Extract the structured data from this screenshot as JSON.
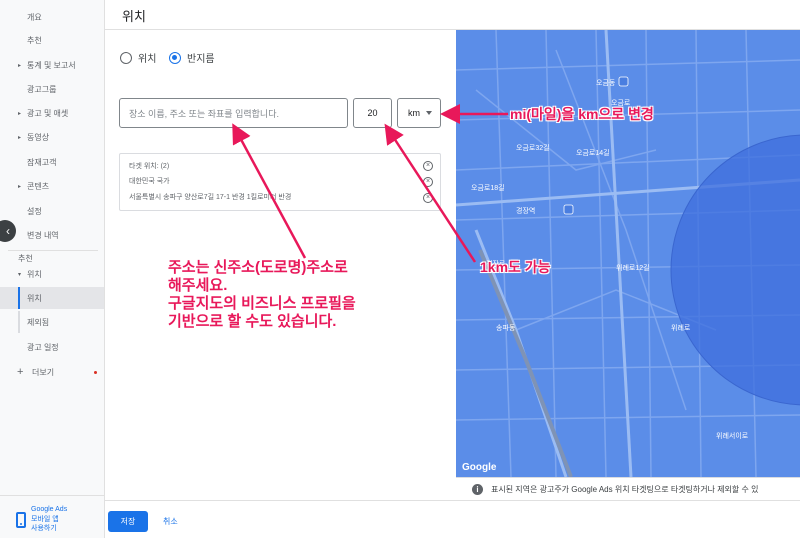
{
  "sidebar": {
    "items": [
      {
        "label": "개요"
      },
      {
        "label": "추천"
      },
      {
        "label": "통계 및 보고서"
      },
      {
        "label": "광고그룹"
      },
      {
        "label": "광고 및 애셋"
      },
      {
        "label": "동영상"
      },
      {
        "label": "잠재고객"
      },
      {
        "label": "콘텐츠"
      },
      {
        "label": "설정"
      },
      {
        "label": "변경 내역"
      }
    ],
    "section_label": "추천",
    "location_group": "위치",
    "sub_items": [
      {
        "label": "위치"
      },
      {
        "label": "제외됨"
      }
    ],
    "ad_schedule": "광고 일정",
    "more": "더보기",
    "footer_line1": "Google Ads",
    "footer_line2": "모바일 앱",
    "footer_line3": "사용하기"
  },
  "header": {
    "title": "위치"
  },
  "radios": {
    "location": "위치",
    "radius": "반지름"
  },
  "search": {
    "placeholder": "장소 이름, 주소 또는 좌표를 입력합니다.",
    "radius_value": "20",
    "unit": "km"
  },
  "targeted": {
    "title": "타겟 위치: (2)",
    "line1": "대한민국 국가",
    "line2": "서울특별시 송파구 양산로7길 17-1 반경 1킬로미터 반경"
  },
  "map": {
    "info": "표시된 지역은 광고주가 Google Ads 위치 타겟팅으로 타겟팅하거나 제외할 수 있",
    "logo": "Google",
    "labels": [
      "오금동",
      "오금로",
      "오금로32길",
      "오금로18길",
      "오금로14길",
      "경장로",
      "경장역",
      "송파동",
      "위례로",
      "위례서이로",
      "위례로12길"
    ]
  },
  "buttons": {
    "save": "저장",
    "cancel": "취소"
  },
  "annotations": {
    "km": "mi(마일)을 km으로 변경",
    "one_km": "1km도 가능",
    "address_1": "주소는 신주소(도로명)주소로",
    "address_2": "해주세요.",
    "address_3": "구글지도의 비즈니스 프로필을",
    "address_4": "기반으로 할 수도 있습니다."
  },
  "colors": {
    "accent": "#1a73e8",
    "annotation": "#e8185a",
    "map_overlay": "#5b8de8",
    "radius_circle": "#3f6fde"
  }
}
